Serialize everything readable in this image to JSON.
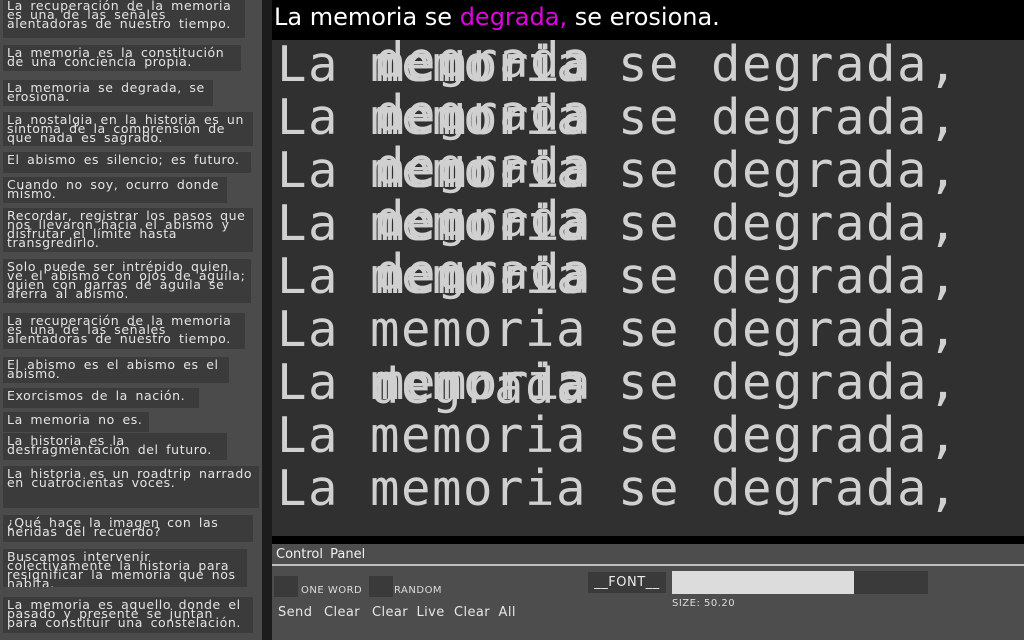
{
  "phrases": [
    {
      "text": "La recuperación de la memoria es una de las señales alentadoras de nuestro tiempo."
    },
    {
      "text": "La memoria es la constitución de una conciencia propia."
    },
    {
      "text": "La memoria se degrada, se erosiona."
    },
    {
      "text": "La nostalgia en la historia es un síntoma de la comprensión de que nada es sagrado."
    },
    {
      "text": "El abismo es silencio; es futuro."
    },
    {
      "text": "Cuando no soy, ocurro donde mismo."
    },
    {
      "text": "Recordar, registrar los pasos que nos llevaron hacia el abismo y disfrutar el límite hasta transgredirlo."
    },
    {
      "text": "Solo puede ser intrépido quien ve el abismo con ojos de águila; quien con garras de águila se aferra al abismo."
    },
    {
      "text": "La recuperación de la memoria es una de las señales alentadoras de nuestro tiempo."
    },
    {
      "text": "El abismo es el abismo es el abismo."
    },
    {
      "text": "Exorcismos de la nación."
    },
    {
      "text": "La memoria no es."
    },
    {
      "text": "La historia es la desfragmentación del futuro."
    },
    {
      "text": "La historia es un roadtrip narrado en cuatrocientas voces."
    },
    {
      "text": "¿Qué hace la imagen con las heridas del recuerdo?"
    },
    {
      "text": "Buscamos intervenir colectivamente la historia para resignificar la memoria que nos habita."
    },
    {
      "text": "La memoria es aquello donde el pasado y presente se juntan para constituir una constelación."
    }
  ],
  "title": {
    "before": "La memoria se ",
    "highlight": "degrada,",
    "after": " se erosiona."
  },
  "stage": {
    "line": "La memoria se degrada,",
    "overlay_words": [
      "memoria",
      "degrada",
      "memoria",
      "degrada",
      "memoria",
      "degrada",
      "memoria",
      "degrada",
      "memoria",
      "degrada",
      "memoria",
      "degrada"
    ]
  },
  "control": {
    "header": "Control Panel",
    "one_word_label": "ONE WORD",
    "random_label": "RANDOM",
    "send_label": "Send",
    "clear_label": "Clear",
    "clear_live_label": "Clear Live",
    "clear_all_label": "Clear All",
    "font_label": "__FONT__",
    "size_label": "SIZE:",
    "size_value": "50.20",
    "size_fraction": 0.71
  },
  "colors": {
    "highlight": "#e000e0",
    "stage_text": "#d0d0d0",
    "stage_bg": "#303030",
    "sidebar_bg": "#4b4b4b",
    "phrase_bg": "#3b3b3b",
    "control_bg": "#4d4d4d"
  }
}
